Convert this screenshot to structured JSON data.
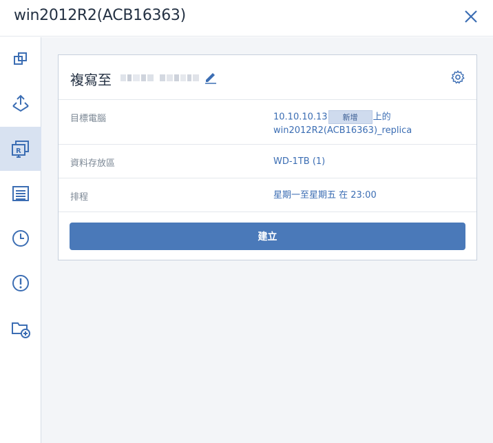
{
  "window": {
    "title": "win2012R2(ACB16363)"
  },
  "sidebar": {
    "items": [
      {
        "icon": "overview-icon",
        "active": false
      },
      {
        "icon": "backup-icon",
        "active": false
      },
      {
        "icon": "replication-icon",
        "active": true
      },
      {
        "icon": "activities-icon",
        "active": false
      },
      {
        "icon": "history-icon",
        "active": false
      },
      {
        "icon": "alert-icon",
        "active": false
      },
      {
        "icon": "add-folder-icon",
        "active": false
      }
    ]
  },
  "plan": {
    "title": "複寫至",
    "rows": [
      {
        "label": "目標電腦",
        "value_prefix": "10.10.10.13",
        "badge": "新增",
        "value_suffix": "上的",
        "value_line2": "win2012R2(ACB16363)_replica"
      },
      {
        "label": "資料存放區",
        "value": "WD-1TB (1)"
      },
      {
        "label": "排程",
        "value": "星期一至星期五 在 23:00"
      }
    ],
    "create_label": "建立"
  },
  "colors": {
    "accent": "#4a79b9",
    "link": "#3b6db3",
    "active_bg": "#d8e2f1"
  }
}
